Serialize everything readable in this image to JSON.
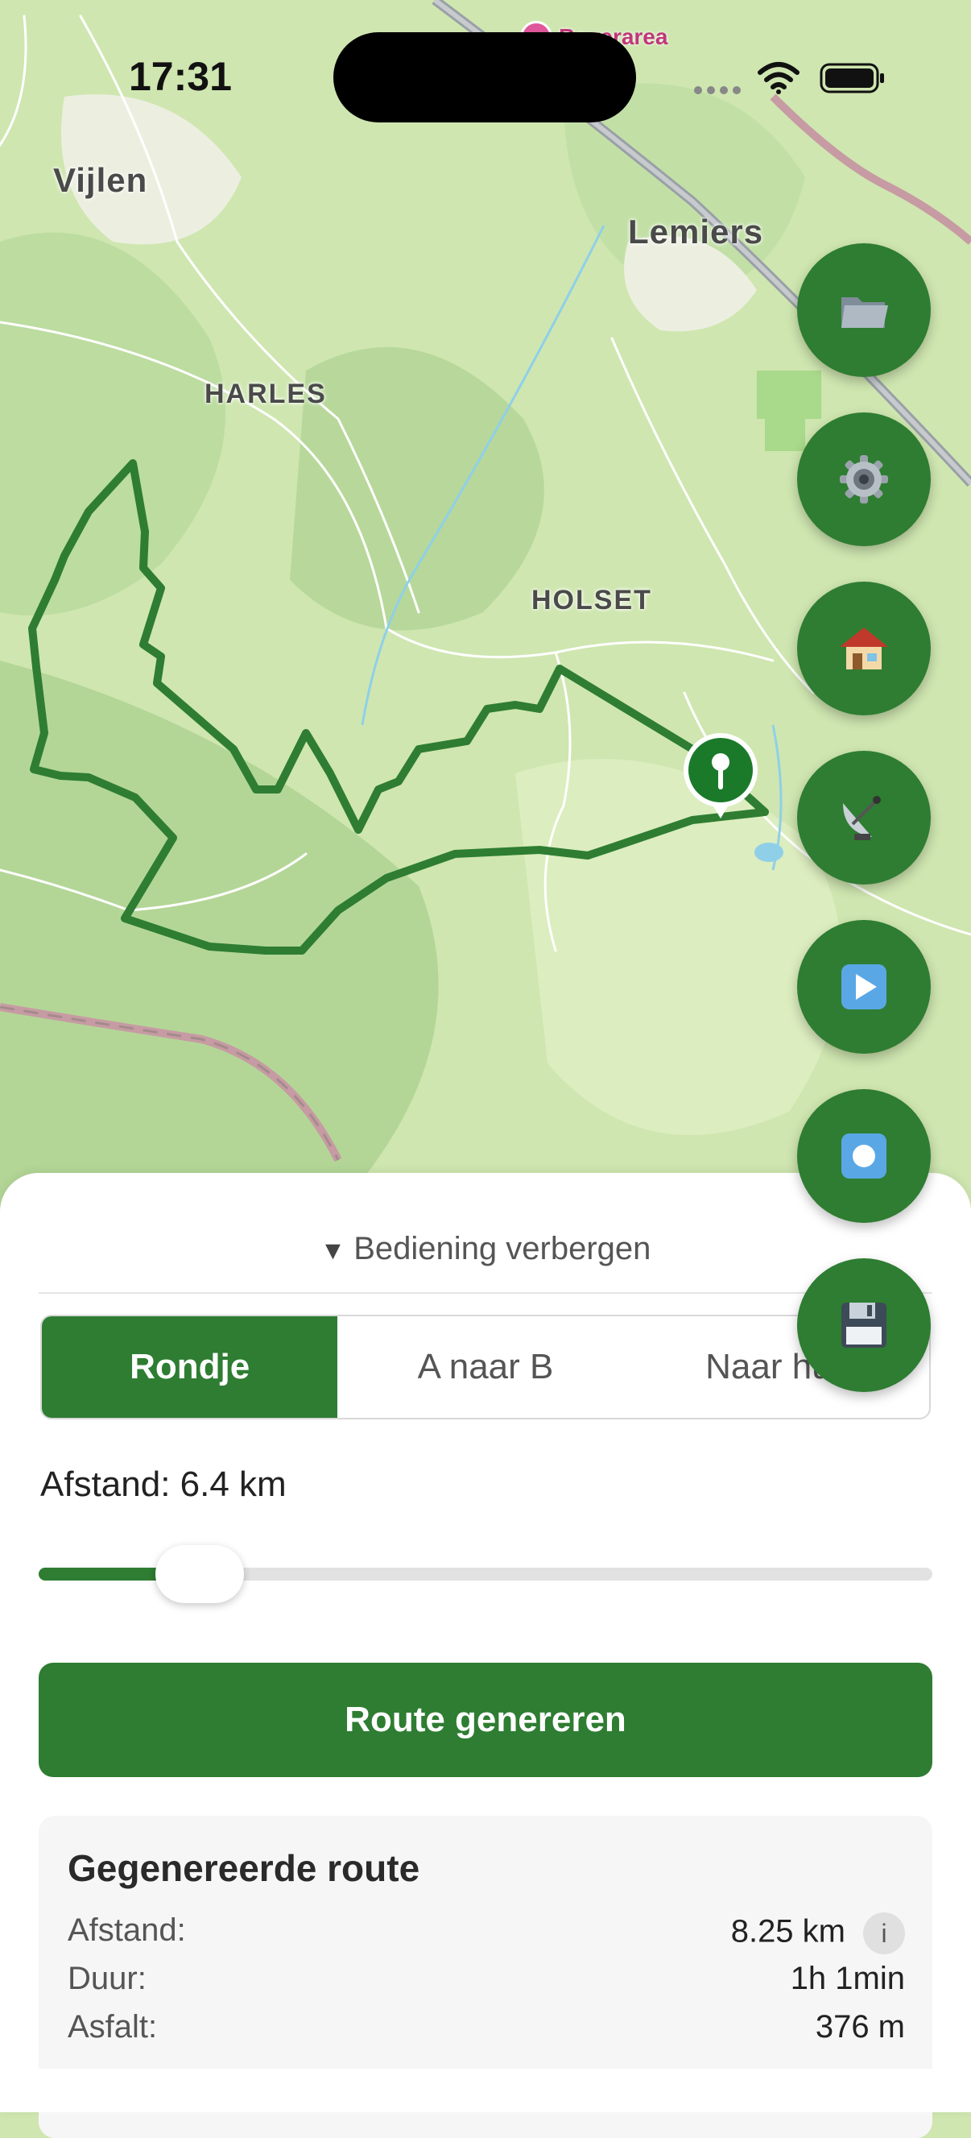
{
  "status_bar": {
    "time": "17:31"
  },
  "map": {
    "places": {
      "vijlen": "Vijlen",
      "lemiers": "Lemiers",
      "harles": "HARLES",
      "holset": "HOLSET",
      "poi": "Beverarea"
    },
    "route_color": "#2e7d32",
    "marker_icon": "location-pin-icon"
  },
  "fab_buttons": [
    {
      "name": "folder-button",
      "icon": "folder-icon"
    },
    {
      "name": "settings-button",
      "icon": "gear-icon"
    },
    {
      "name": "home-button",
      "icon": "house-icon"
    },
    {
      "name": "gps-button",
      "icon": "satellite-dish-icon"
    },
    {
      "name": "play-button",
      "icon": "play-icon"
    },
    {
      "name": "record-button",
      "icon": "record-icon"
    },
    {
      "name": "save-button",
      "icon": "floppy-disk-icon"
    }
  ],
  "panel": {
    "toggle_label": "Bediening verbergen",
    "tabs": [
      {
        "label": "Rondje",
        "active": true
      },
      {
        "label": "A naar B",
        "active": false
      },
      {
        "label": "Naar huis",
        "active": false
      }
    ],
    "distance_label": "Afstand: 6.4 km",
    "slider_value": 0.18,
    "generate_button": "Route genereren",
    "result": {
      "title": "Gegenereerde route",
      "rows": [
        {
          "label": "Afstand:",
          "value": "8.25 km"
        },
        {
          "label": "Duur:",
          "value": "1h 1min"
        },
        {
          "label": "Asfalt:",
          "value": "376 m"
        }
      ]
    }
  },
  "colors": {
    "accent": "#2e7d32",
    "map_base": "#cfe6b0"
  }
}
